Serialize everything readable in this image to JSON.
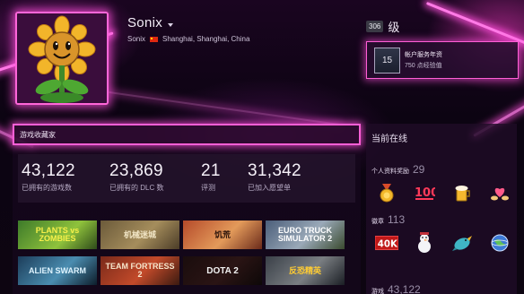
{
  "profile": {
    "persona_name": "Sonix",
    "location_line": "Sonix",
    "location": "Shanghai, Shanghai, China"
  },
  "level": {
    "number": "306",
    "label": "级"
  },
  "favorite_badge": {
    "icon_text": "15",
    "title": "帐户服务年资",
    "xp": "750 点经验值"
  },
  "showcase": {
    "title": "游戏收藏家",
    "stats": [
      {
        "value": "43,122",
        "label": "已拥有的游戏数"
      },
      {
        "value": "23,869",
        "label": "已拥有的 DLC 数"
      },
      {
        "value": "21",
        "label": "评测"
      },
      {
        "value": "31,342",
        "label": "已加入愿望单"
      }
    ],
    "games": [
      {
        "title": "PLANTS vs ZOMBIES"
      },
      {
        "title": "机械迷城"
      },
      {
        "title": "饥荒"
      },
      {
        "title": "EURO TRUCK SIMULATOR 2"
      },
      {
        "title": "ALIEN SWARM"
      },
      {
        "title": "TEAM FORTRESS 2"
      },
      {
        "title": "DOTA 2"
      },
      {
        "title": "反恐精英"
      }
    ]
  },
  "sidebar": {
    "status": "当前在线",
    "awards_label": "个人资料奖励",
    "awards_count": "29",
    "awards_icons": [
      "gold-medal-icon",
      "hundred-icon",
      "beer-icon",
      "heart-hands-icon"
    ],
    "badges_label": "徽章",
    "badges_count": "113",
    "badge_icons": [
      "40k-badge-icon",
      "snowman-badge-icon",
      "bird-badge-icon",
      "globe-badge-icon"
    ],
    "games_label": "游戏",
    "games_count": "43,122"
  },
  "colors": {
    "neon": "#ff5fd6",
    "background": "#0a0410"
  }
}
